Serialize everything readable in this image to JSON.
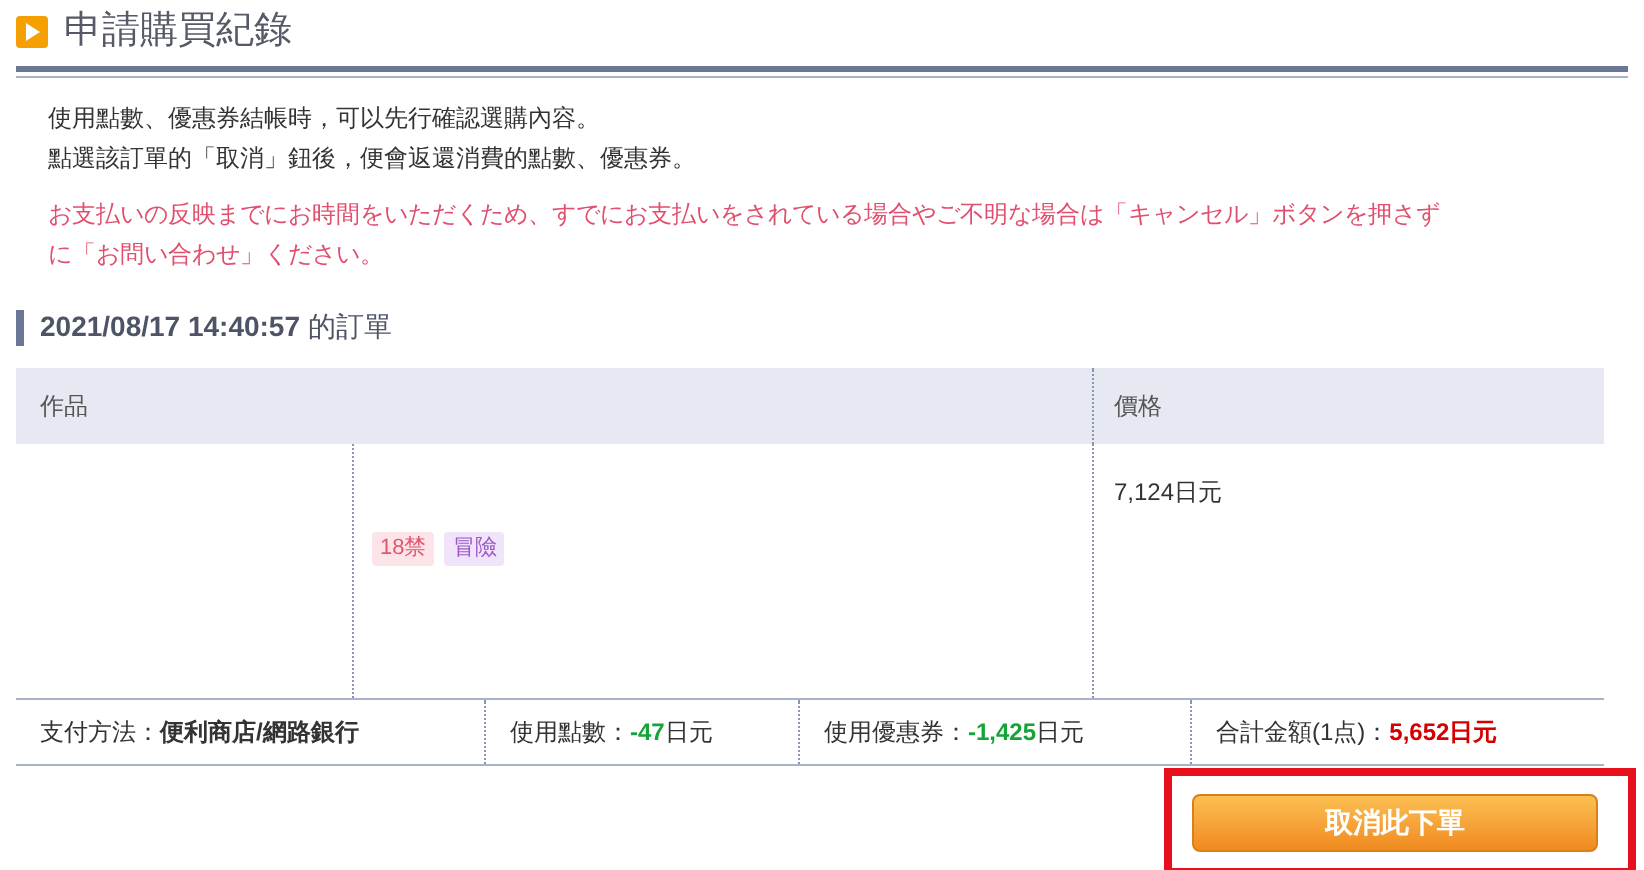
{
  "title": "申請購買紀錄",
  "intro": [
    "使用點數、優惠券結帳時，可以先行確認選購內容。",
    "點選該訂單的「取消」鈕後，便會返還消費的點數、優惠券。"
  ],
  "notice": [
    "お支払いの反映までにお時間をいただくため、すでにお支払いをされている場合やご不明な場合は「キャンセル」ボタンを押さず",
    "に「お問い合わせ」ください。"
  ],
  "order": {
    "date": "2021/08/17 14:40:57",
    "suffix": "的訂單"
  },
  "table": {
    "columns": [
      "作品",
      "價格"
    ],
    "rows": [
      {
        "tags": [
          {
            "label": "18禁",
            "color": "#fde4e8"
          },
          {
            "label": "冒險",
            "color": "#f0e4fb"
          }
        ],
        "price": "7,124日元"
      }
    ]
  },
  "summary": [
    {
      "label": "支付方法：",
      "value": "便利商店/網路銀行",
      "kind": "plain"
    },
    {
      "label": "使用點數：",
      "value": "-47",
      "unit": "日元",
      "kind": "discount"
    },
    {
      "label": "使用優惠券：",
      "value": "-1,425",
      "unit": "日元",
      "kind": "discount"
    },
    {
      "label": "合計金額(1点)：",
      "value": "5,652日元",
      "kind": "total"
    }
  ],
  "cancel_button": {
    "label": "取消此下單",
    "highlighted": true
  }
}
